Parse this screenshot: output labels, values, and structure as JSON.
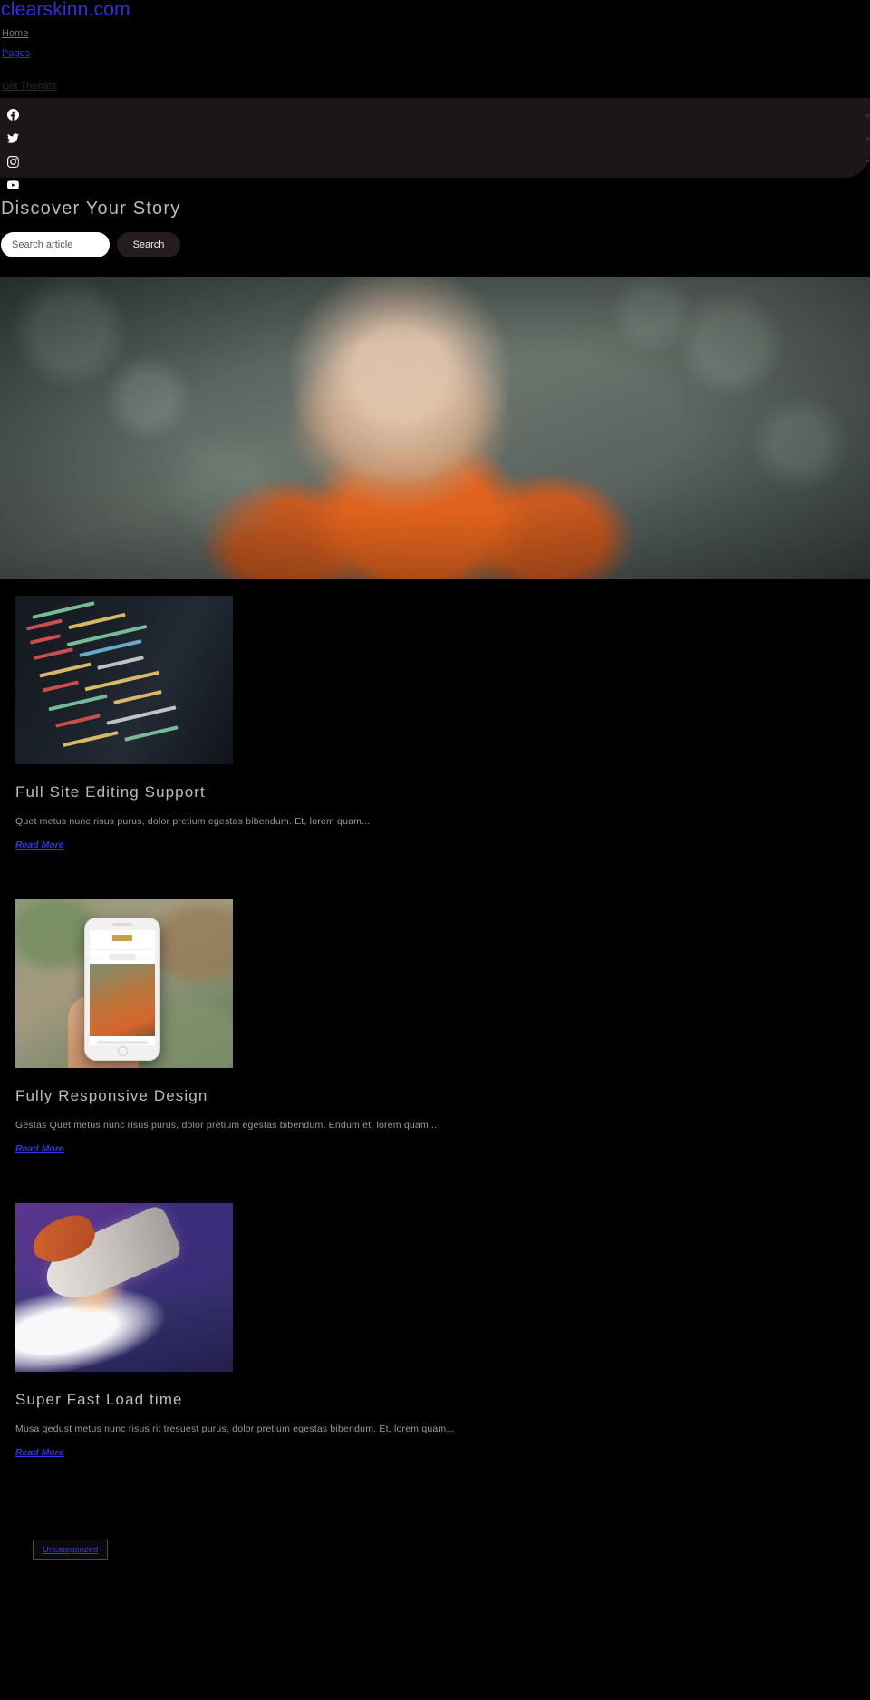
{
  "site": {
    "title": "clearskinn.com",
    "nav": [
      {
        "label": "Home",
        "style": "home"
      },
      {
        "label": "Pages",
        "style": "link"
      },
      {
        "label": "Get Themes",
        "style": "muted"
      }
    ],
    "social": [
      {
        "name": "facebook-icon",
        "label": "Facebook"
      },
      {
        "name": "twitter-icon",
        "label": "Twitter"
      },
      {
        "name": "instagram-icon",
        "label": "Instagram"
      },
      {
        "name": "youtube-icon",
        "label": "YouTube"
      }
    ]
  },
  "hero": {
    "heading": "Discover Your Story",
    "search_placeholder": "Search article",
    "search_value": "",
    "search_button": "Search"
  },
  "featured": {
    "alt": "Woman in orange coat with curly hair outdoors in winter"
  },
  "posts": [
    {
      "title": "Full Site Editing Support",
      "excerpt": "Quet metus nunc risus purus, dolor pretium egestas bibendum. Et, lorem quam...",
      "read_more": "Read More",
      "thumb": "code-editor-screen"
    },
    {
      "title": "Fully Responsive Design",
      "excerpt": "Gestas Quet metus nunc risus purus, dolor pretium egestas bibendum. Endum et, lorem quam...",
      "read_more": "Read More",
      "thumb": "hand-holding-phone"
    },
    {
      "title": "Super Fast Load time",
      "excerpt": "Musa gedust metus nunc risus rit tresuest purus, dolor pretium egestas bibendum. Et, lorem quam...",
      "read_more": "Read More",
      "thumb": "space-shuttle-launch"
    }
  ],
  "footer": {
    "category_label": "Uncategorized"
  },
  "colors": {
    "background": "#000000",
    "link": "#3030e8",
    "bar": "#1d1616",
    "text": "#bcbcbc"
  }
}
